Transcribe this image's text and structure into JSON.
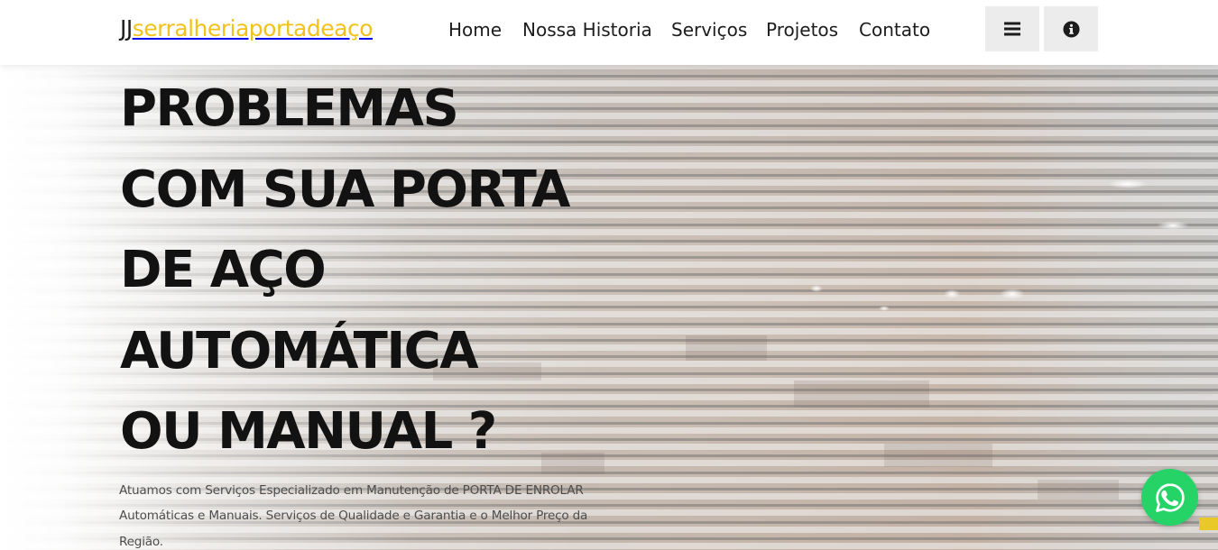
{
  "colors": {
    "accent": "#f2c21b",
    "text_dark": "#121212",
    "whatsapp_green": "#25d366",
    "button_bg": "#ececec"
  },
  "header": {
    "logo_prefix": "JJ",
    "logo_suffix": "serralheriaportadeaço",
    "nav": [
      "Home",
      "Nossa Historia",
      "Serviços",
      "Projetos",
      "Contato"
    ],
    "menu_icon": "hamburger-menu-icon",
    "info_icon": "info-circle-icon"
  },
  "hero": {
    "headline_lines": [
      "PROBLEMAS",
      "COM SUA PORTA",
      "DE AÇO",
      "AUTOMÁTICA",
      "OU MANUAL ?"
    ],
    "description": "Atuamos com Serviços Especializado em Manutenção de PORTA DE ENROLAR Automáticas e Manuais. Serviços de Qualidade e Garantia e o Melhor Preço da Região.",
    "background": "rolling-steel-shutter-photo"
  },
  "floating": {
    "whatsapp_icon": "whatsapp-icon"
  }
}
